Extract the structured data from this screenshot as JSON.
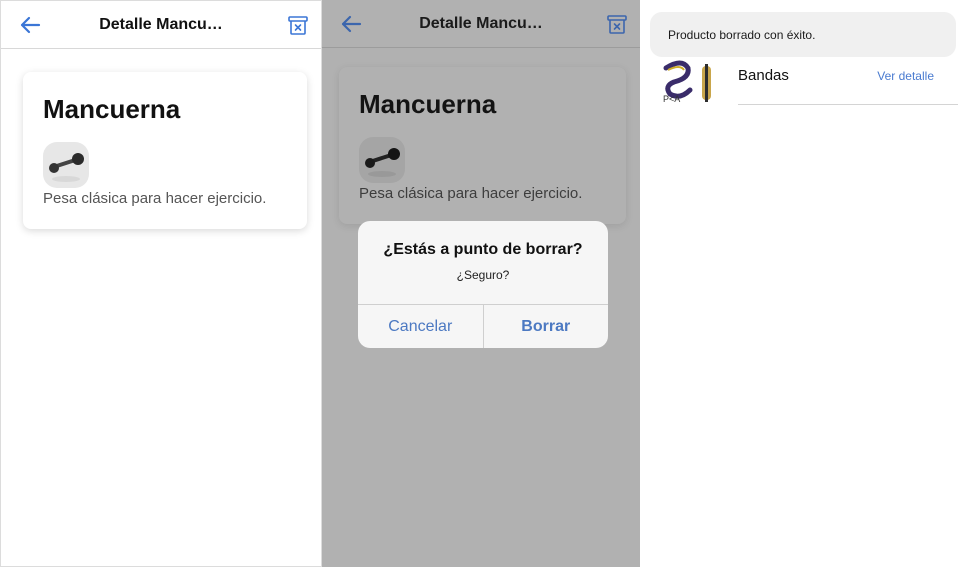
{
  "screen1": {
    "header": {
      "title": "Detalle Mancu…",
      "back_icon": "arrow-left-icon",
      "delete_icon": "trash-icon"
    },
    "product": {
      "name": "Mancuerna",
      "description": "Pesa clásica para hacer ejercicio.",
      "image_icon": "dumbbell-icon"
    }
  },
  "screen2": {
    "header": {
      "title": "Detalle Mancu…",
      "back_icon": "arrow-left-icon",
      "delete_icon": "trash-icon"
    },
    "product": {
      "name": "Mancuerna",
      "description": "Pesa clásica para hacer ejercicio.",
      "image_icon": "dumbbell-icon"
    },
    "dialog": {
      "title": "¿Estás a punto de borrar?",
      "message": "¿Seguro?",
      "cancel_label": "Cancelar",
      "confirm_label": "Borrar"
    }
  },
  "screen3": {
    "toast": {
      "message": "Producto borrado con éxito."
    },
    "list": [
      {
        "name": "Bandas",
        "link": "Ver detalle"
      }
    ]
  },
  "colors": {
    "accent": "#4a7bd0",
    "overlay": "#b1b1b1",
    "dialog_bg": "#f6f6f6"
  }
}
